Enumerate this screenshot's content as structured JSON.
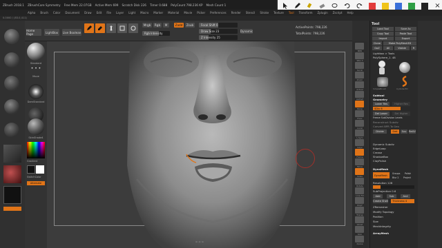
{
  "window": {
    "title": "ZBrush 2018.1",
    "items": [
      "ZBrush 2018.1",
      "ZBrushCore Symmetry",
      "Free Mem 22.07GB",
      "Active Mem 699",
      "Scratch Disk 226",
      "Timer 0.688",
      "PolyCount 798.236 KP",
      "Mesh Count 1"
    ],
    "right": {
      "quicksave": "QuickSave",
      "seethrough": "See-through 0",
      "menus": "Menus",
      "script": "DefaultZScript"
    }
  },
  "overlay_toolbar": {
    "icons": [
      "pointer-icon",
      "pen-icon",
      "highlighter-icon",
      "eraser-icon",
      "lasso-icon",
      "undo-icon",
      "redo-icon"
    ],
    "colors": [
      "#e23b3b",
      "#f0c419",
      "#3a6fd8",
      "#2e9e44",
      "#222222"
    ],
    "close": "×"
  },
  "menus": [
    "Alpha",
    "Brush",
    "Color",
    "Document",
    "Draw",
    "Edit",
    "File",
    "Layer",
    "Light",
    "Macro",
    "Marker",
    "Material",
    "Movie",
    "Picker",
    "Preferences",
    "Render",
    "Stencil",
    "Stroke",
    "Texture",
    "Tool",
    "Transform",
    "Zplugin",
    "Zscript",
    "Help"
  ],
  "menus_highlight": "Tool",
  "status": "0.0000 / (83.0,411)",
  "shelf": {
    "home": "Home Page",
    "lightbox": "LightBox",
    "live_boolean": "Live Boolean",
    "tools": [
      "Edit",
      "Draw",
      "Move",
      "Scale",
      "Rotate"
    ],
    "mrgb": "Mrgb",
    "rgb": "Rgb",
    "m": "M",
    "zadd": "Zadd",
    "zsub": "Zsub",
    "rgb_intensity": "Rgb Intensity",
    "focal_shift": "Focal Shift 0",
    "draw_size": "Draw Size 23",
    "z_intensity": "Z Intensity 25",
    "dynamic": "Dynamic",
    "active_points": "ActivePoints: 798,226",
    "total_points": "TotalPoints: 798,226"
  },
  "left": {
    "brushes": [
      "Standard",
      "Move",
      "DamStandard",
      "ClayBuildup",
      "hPolish",
      "TrimDynamic"
    ],
    "materials": [
      "MatCap Red",
      "SkinShade4"
    ],
    "gradient": "Gradient",
    "switch_color": "SwitchColor",
    "alternate": "Alternate"
  },
  "iconcol": [
    "BPR",
    "SPix 3",
    "Scroll",
    "Zoom",
    "Actual",
    "AAHalf",
    "Persp",
    "Floor",
    "Local",
    "L.Sym",
    "Gxyz",
    "Frame",
    "Move",
    "Scale",
    "Rotate",
    "Line Fill",
    "PolyF",
    "Transp",
    "Ghost",
    "Solo",
    "Xpose"
  ],
  "palette": {
    "title": "Tool",
    "top_buttons": [
      "Load Tool",
      "Save As",
      "Copy Tool",
      "Paste Tool",
      "Import",
      "Export",
      "Clone",
      "Make PolyMesh3D",
      "GoZ",
      "All",
      "Visible",
      "R"
    ],
    "lightbox_tools": "Lightbox > Tools",
    "polysphere": "PolySphere_1. 48",
    "thumbs": [
      "PolySphere",
      "PolySphere_1",
      "SimpleBrush",
      "Cylinder3D"
    ],
    "subtool": "Subtool",
    "geometry": "Geometry",
    "lower_res": "Lower Res",
    "higher_res": "Higher Res",
    "sdiv": "SDiv 6",
    "del_lower": "Del Lower",
    "del_higher": "Del Higher",
    "freeze": "Freeze SubDivision Levels",
    "reconstruct": "Reconstruct Subdiv",
    "convert_bpr": "Convert BPR To Geo",
    "divide": "Divide",
    "smt": "Smt",
    "suv": "Suv",
    "reuv": "ReUV",
    "items_mid": [
      "Dynamic Subdiv",
      "EdgeLoop",
      "Crease",
      "ShadowBox",
      "ClayPolish"
    ],
    "dynamesh": "DynaMesh",
    "dynamesh_btn": "DynaMesh",
    "groups": "Groups",
    "polish": "Polish",
    "blur": "Blur 2",
    "project": "Project",
    "resolution": "Resolution 128",
    "subprojection": "SubProjection 0.6",
    "add": "Add",
    "sub": "Sub",
    "and": "And",
    "create_shell": "Create Shell",
    "thickness": "Thickness 4",
    "items_low": [
      "ZRemesher",
      "Modify Topology",
      "Position",
      "Size",
      "MeshIntegrity"
    ],
    "arraymesh": "ArrayMesh"
  }
}
